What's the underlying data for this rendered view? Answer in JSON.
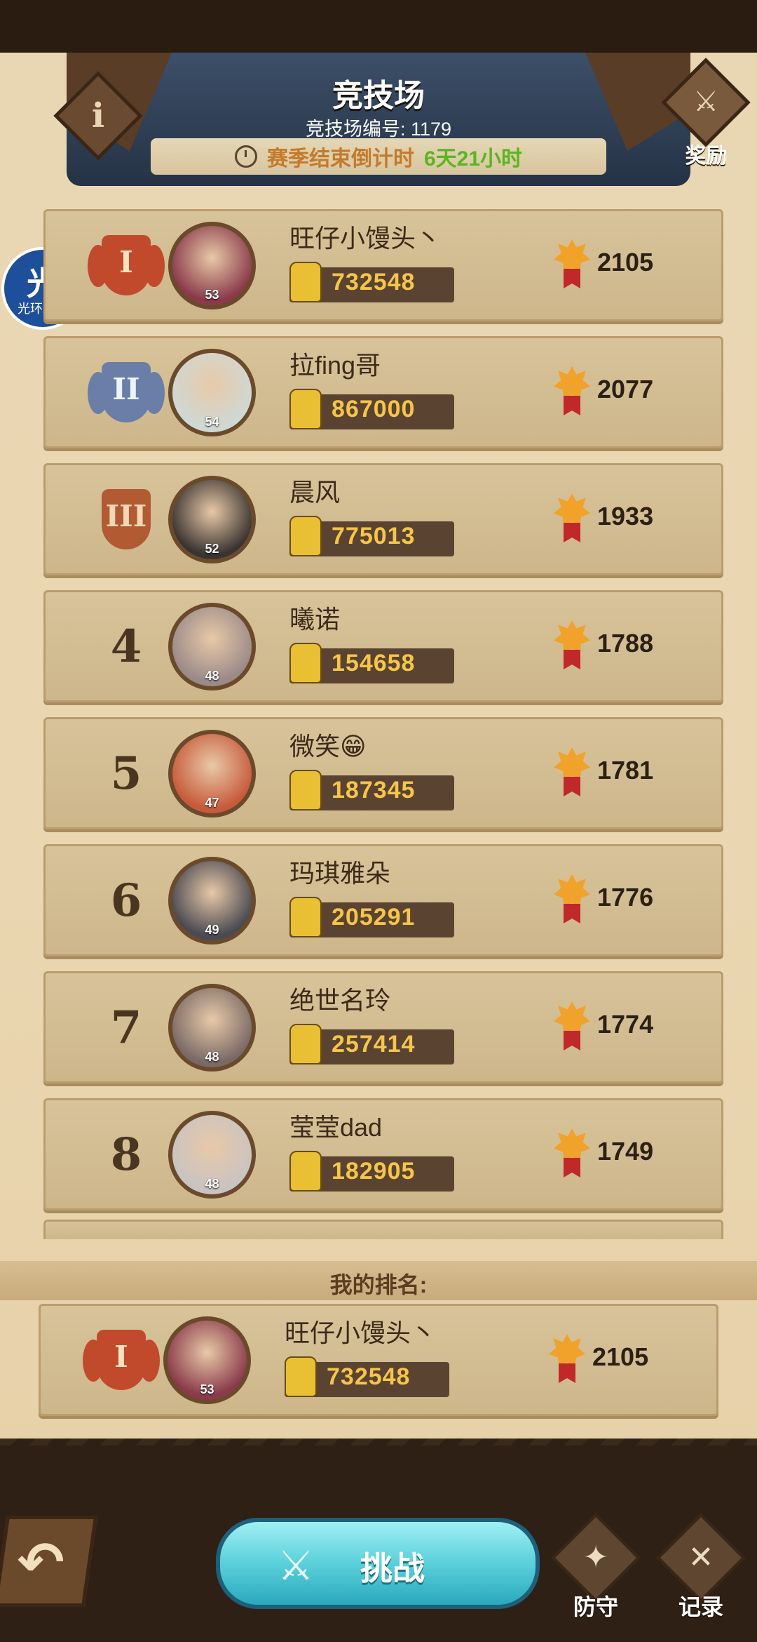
{
  "header": {
    "title": "竞技场",
    "arena_number": "竞技场编号: 1179",
    "countdown_label": "赛季结束倒计时",
    "countdown_value": "6天21小时",
    "reward_label": "奖励",
    "info_icon": "i"
  },
  "overlay_badge": {
    "glyph": "光",
    "label": "光环助手"
  },
  "leaderboard": [
    {
      "rank": "1",
      "rank_medal": "gold",
      "medal_roman": "I",
      "name": "旺仔小馒头丶",
      "level": "53",
      "power": "732548",
      "score": "2105",
      "avatar_color": "#8a3a4a"
    },
    {
      "rank": "2",
      "rank_medal": "silver",
      "medal_roman": "II",
      "name": "拉fing哥",
      "level": "54",
      "power": "867000",
      "score": "2077",
      "avatar_color": "#cfd8d4"
    },
    {
      "rank": "3",
      "rank_medal": "bronze",
      "medal_roman": "III",
      "name": "晨风",
      "level": "52",
      "power": "775013",
      "score": "1933",
      "avatar_color": "#3a3430"
    },
    {
      "rank": "4",
      "name": "曦诺",
      "level": "48",
      "power": "154658",
      "score": "1788",
      "avatar_color": "#9a8a88"
    },
    {
      "rank": "5",
      "name": "微笑😁",
      "level": "47",
      "power": "187345",
      "score": "1781",
      "avatar_color": "#c75a3a"
    },
    {
      "rank": "6",
      "name": "玛琪雅朵",
      "level": "49",
      "power": "205291",
      "score": "1776",
      "avatar_color": "#4a4a52"
    },
    {
      "rank": "7",
      "name": "绝世名玲",
      "level": "48",
      "power": "257414",
      "score": "1774",
      "avatar_color": "#7a6a66"
    },
    {
      "rank": "8",
      "name": "莹莹dad",
      "level": "48",
      "power": "182905",
      "score": "1749",
      "avatar_color": "#c9c3c1"
    }
  ],
  "my_rank": {
    "label": "我的排名:",
    "rank_medal": "gold",
    "medal_roman": "I",
    "name": "旺仔小馒头丶",
    "level": "53",
    "power": "732548",
    "score": "2105",
    "avatar_color": "#8a3a4a"
  },
  "bottom": {
    "challenge_label": "挑战",
    "defend_label": "防守",
    "record_label": "记录"
  }
}
